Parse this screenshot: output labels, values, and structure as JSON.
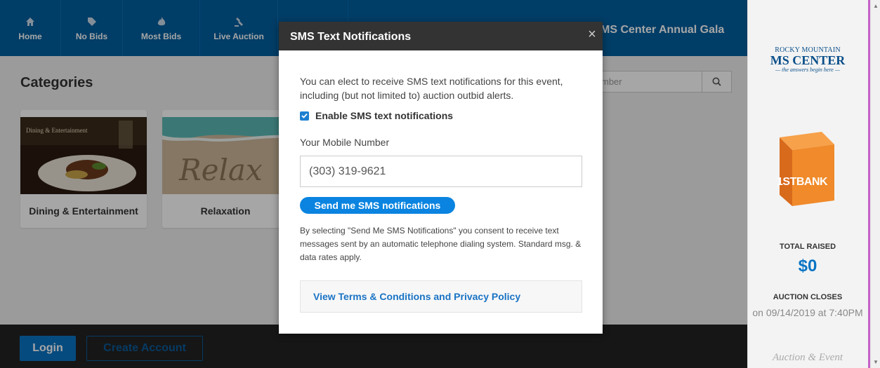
{
  "nav": {
    "items": [
      {
        "label": "Home",
        "icon": "home-icon"
      },
      {
        "label": "No Bids",
        "icon": "tag-icon"
      },
      {
        "label": "Most Bids",
        "icon": "fire-icon"
      },
      {
        "label": "Live Auction",
        "icon": "gavel-icon"
      },
      {
        "label": "",
        "icon": "heart-icon"
      }
    ],
    "event_title": "MS Center Annual Gala"
  },
  "categories": {
    "title": "Categories",
    "search_placeholder": "mber",
    "items": [
      {
        "label": "Dining & Entertainment",
        "image_text": "Dining & Entertainment"
      },
      {
        "label": "Relaxation",
        "image_text": "Relax"
      }
    ]
  },
  "footer": {
    "login_label": "Login",
    "create_account_label": "Create Account"
  },
  "sidebar": {
    "logo_line1": "ROCKY MOUNTAIN",
    "logo_line2": "MS CENTER",
    "logo_line3": "— the answers begin here —",
    "sponsor_text": "1STBANK",
    "total_raised_label": "TOTAL RAISED",
    "total_raised_value": "$0",
    "auction_closes_label": "AUCTION CLOSES",
    "auction_closes_date": "on 09/14/2019 at 7:40PM",
    "bottom_sponsor": "Auction & Event"
  },
  "modal": {
    "title": "SMS Text Notifications",
    "close_glyph": "×",
    "intro": "You can elect to receive SMS text notifications for this event, including (but not limited to) auction outbid alerts.",
    "enable_label": "Enable SMS text notifications",
    "enable_checked": true,
    "mobile_label": "Your Mobile Number",
    "mobile_value": "(303) 319-9621",
    "send_button": "Send me SMS notifications",
    "consent": "By selecting \"Send Me SMS Notifications\" you consent to receive text messages sent by an automatic telephone dialing system. Standard msg. & data rates apply.",
    "terms_link": "View Terms & Conditions and Privacy Policy"
  },
  "colors": {
    "nav_bg": "#005e9e",
    "accent": "#0a84e0",
    "modal_header": "#333333",
    "footer_bg": "#222222"
  }
}
